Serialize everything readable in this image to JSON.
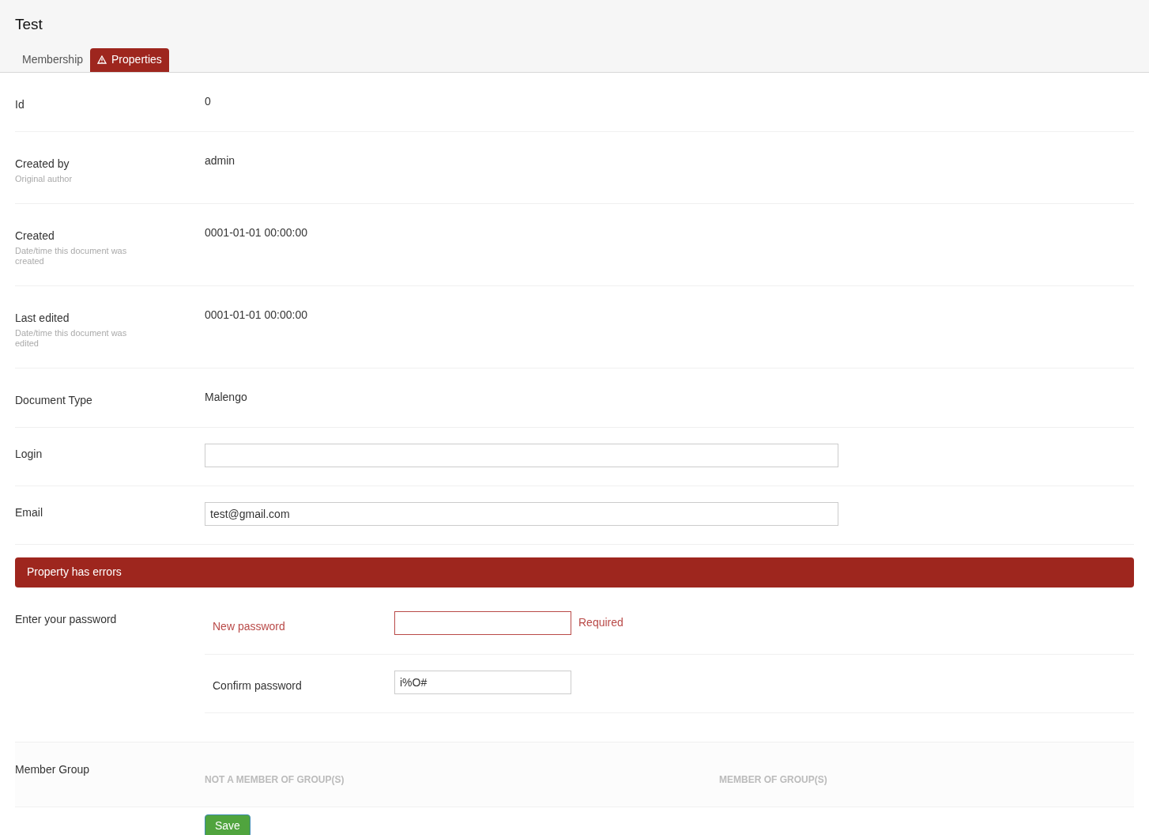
{
  "title": "Test",
  "tabs": [
    {
      "label": "Membership",
      "selected": false,
      "warning": false
    },
    {
      "label": "Properties",
      "selected": true,
      "warning": true
    }
  ],
  "properties": [
    {
      "kind": "text",
      "label": "Id",
      "value": "0"
    },
    {
      "kind": "text",
      "label": "Created by",
      "description": "Original author",
      "value": "admin"
    },
    {
      "kind": "text",
      "label": "Created",
      "description": "Date/time this document was created",
      "value": "0001-01-01 00:00:00"
    },
    {
      "kind": "text",
      "label": "Last edited",
      "description": "Date/time this document was edited",
      "value": "0001-01-01 00:00:00"
    },
    {
      "kind": "text",
      "label": "Document Type",
      "value": "Malengo"
    },
    {
      "kind": "input",
      "label": "Login"
    },
    {
      "kind": "input",
      "label": "Email",
      "value": "test@gmail.com"
    }
  ],
  "error_banner": "Property has errors",
  "password": {
    "label": "Enter your password",
    "fields": [
      {
        "label": "New password",
        "error": true,
        "message": "Required"
      },
      {
        "label": "Confirm password",
        "value": "i%O#",
        "error": false
      }
    ]
  },
  "member_group": {
    "label": "Member Group",
    "available_heading": "NOT A MEMBER OF GROUP(S)",
    "member_heading": "MEMBER OF GROUP(S)"
  },
  "save_button": "Save"
}
